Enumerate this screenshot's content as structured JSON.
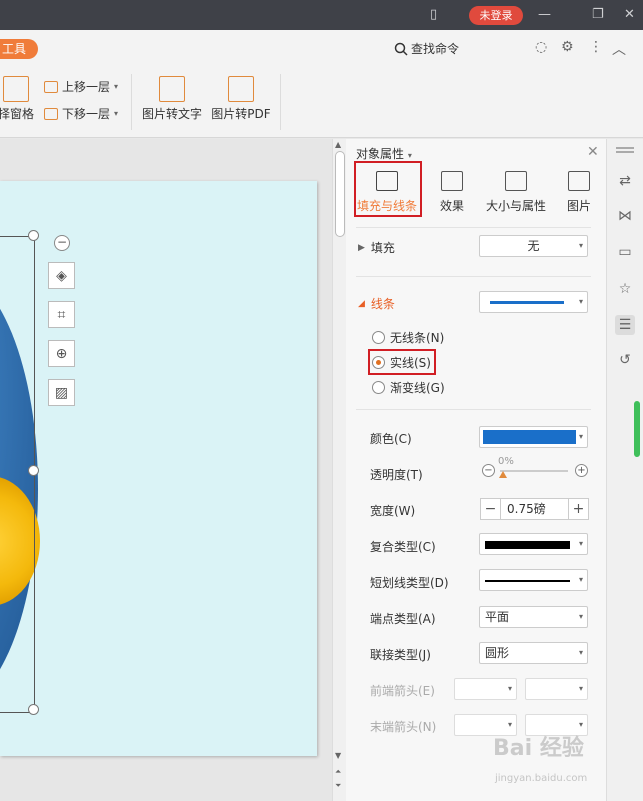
{
  "titlebar": {
    "login_label": "未登录"
  },
  "tabrow": {
    "tool_tab": "工具",
    "search_cmd": "查找命令"
  },
  "ribbon": {
    "select_pane": "择窗格",
    "move_up": "上移一层",
    "move_down": "下移一层",
    "img_to_text": "图片转文字",
    "img_to_pdf": "图片转PDF"
  },
  "panel": {
    "title": "对象属性",
    "tabs": [
      {
        "label": "填充与线条",
        "active": true
      },
      {
        "label": "效果"
      },
      {
        "label": "大小与属性"
      },
      {
        "label": "图片"
      }
    ],
    "fill": {
      "label": "填充",
      "value": "无"
    },
    "line": {
      "label": "线条",
      "options": [
        "无线条(N)",
        "实线(S)",
        "渐变线(G)"
      ],
      "selected": "实线(S)"
    },
    "props": {
      "color": "颜色(C)",
      "transparency": "透明度(T)",
      "transparency_value": "0%",
      "width": "宽度(W)",
      "width_value": "0.75磅",
      "compound": "复合类型(C)",
      "dash": "短划线类型(D)",
      "cap": "端点类型(A)",
      "cap_value": "平面",
      "join": "联接类型(J)",
      "join_value": "圆形",
      "begin_arrow": "前端箭头(E)",
      "end_arrow": "末端箭头(N)"
    },
    "line_color": "#1a6fc9"
  },
  "watermark": {
    "main": "Bai 经验",
    "sub": "jingyan.baidu.com"
  }
}
